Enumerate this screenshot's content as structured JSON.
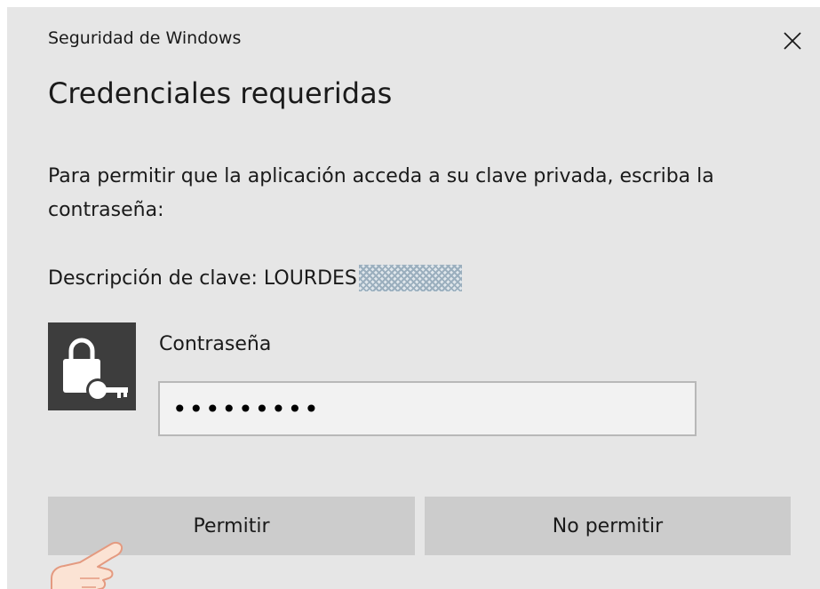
{
  "window": {
    "title": "Seguridad de Windows",
    "close_icon": "close-icon"
  },
  "dialog": {
    "heading": "Credenciales requeridas",
    "message": "Para permitir que la aplicación acceda a su clave privada, escriba la contraseña:",
    "key_description": "Descripción de clave: LOURDES",
    "key_description_redacted": true
  },
  "password": {
    "label": "Contraseña",
    "value": "•••••••••",
    "icon": "lock-key-icon"
  },
  "buttons": {
    "allow": "Permitir",
    "deny": "No permitir"
  },
  "colors": {
    "dialog_bg": "#e6e6e6",
    "button_bg": "#cccccc",
    "lock_tile_bg": "#3d3d3d",
    "pointer_hand": "#fbe3d4"
  }
}
